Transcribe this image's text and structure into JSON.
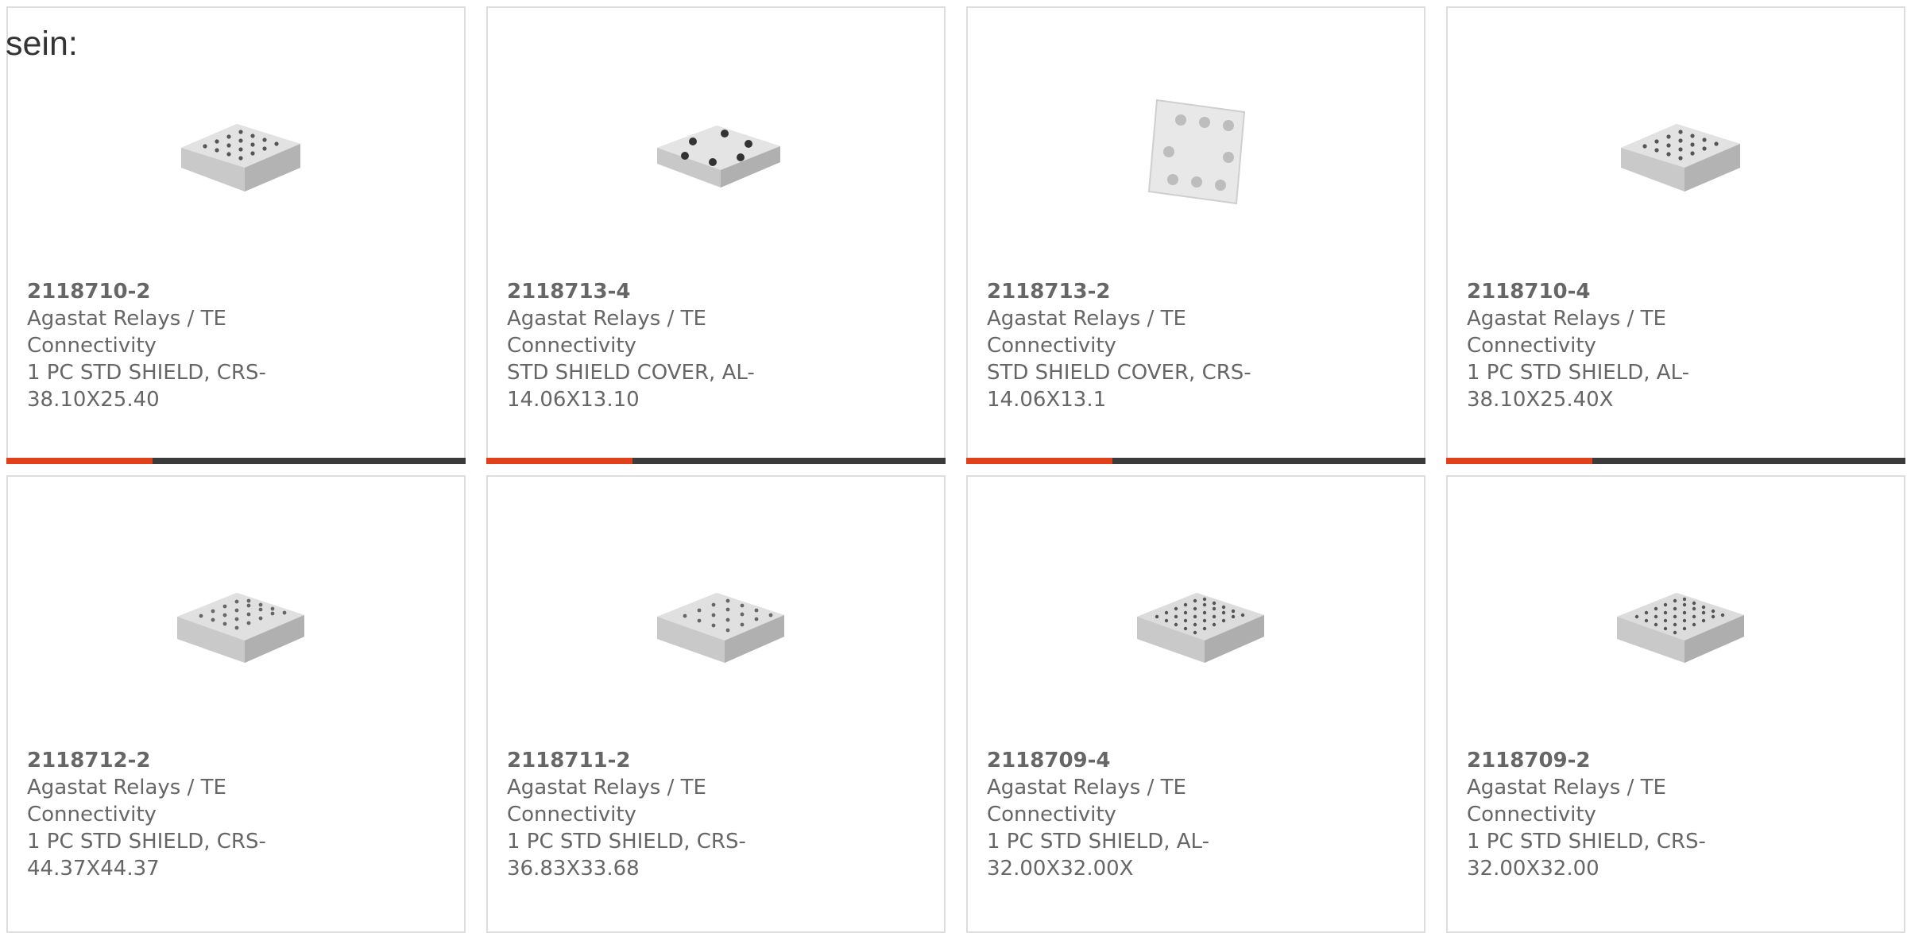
{
  "intro_text": "sein:",
  "accent_color": "#e0401a",
  "products": [
    {
      "part_number": "2118710-2",
      "manufacturer": "Agastat Relays / TE Connectivity",
      "desc_line1": "1 PC STD SHIELD, CRS-",
      "desc_line2": "38.10X25.40",
      "image_icon": "rect-shield-image"
    },
    {
      "part_number": "2118713-4",
      "manufacturer": "Agastat Relays / TE Connectivity",
      "desc_line1": "STD SHIELD COVER, AL-",
      "desc_line2": "14.06X13.10",
      "image_icon": "square-cover-image"
    },
    {
      "part_number": "2118713-2",
      "manufacturer": "Agastat Relays / TE Connectivity",
      "desc_line1": "STD SHIELD COVER, CRS-",
      "desc_line2": "14.06X13.1",
      "image_icon": "tilted-cover-image"
    },
    {
      "part_number": "2118710-4",
      "manufacturer": "Agastat Relays / TE Connectivity",
      "desc_line1": "1 PC STD SHIELD, AL-",
      "desc_line2": "38.10X25.40X",
      "image_icon": "rect-shield-image"
    },
    {
      "part_number": "2118712-2",
      "manufacturer": "Agastat Relays / TE Connectivity",
      "desc_line1": "1 PC STD SHIELD, CRS-",
      "desc_line2": "44.37X44.37",
      "image_icon": "square-shield-image"
    },
    {
      "part_number": "2118711-2",
      "manufacturer": "Agastat Relays / TE Connectivity",
      "desc_line1": "1 PC STD SHIELD, CRS-",
      "desc_line2": "36.83X33.68",
      "image_icon": "square-shield-image"
    },
    {
      "part_number": "2118709-4",
      "manufacturer": "Agastat Relays / TE Connectivity",
      "desc_line1": "1 PC STD SHIELD, AL-",
      "desc_line2": "32.00X32.00X",
      "image_icon": "square-shield-image"
    },
    {
      "part_number": "2118709-2",
      "manufacturer": "Agastat Relays / TE Connectivity",
      "desc_line1": "1 PC STD SHIELD, CRS-",
      "desc_line2": "32.00X32.00",
      "image_icon": "square-shield-image"
    }
  ]
}
